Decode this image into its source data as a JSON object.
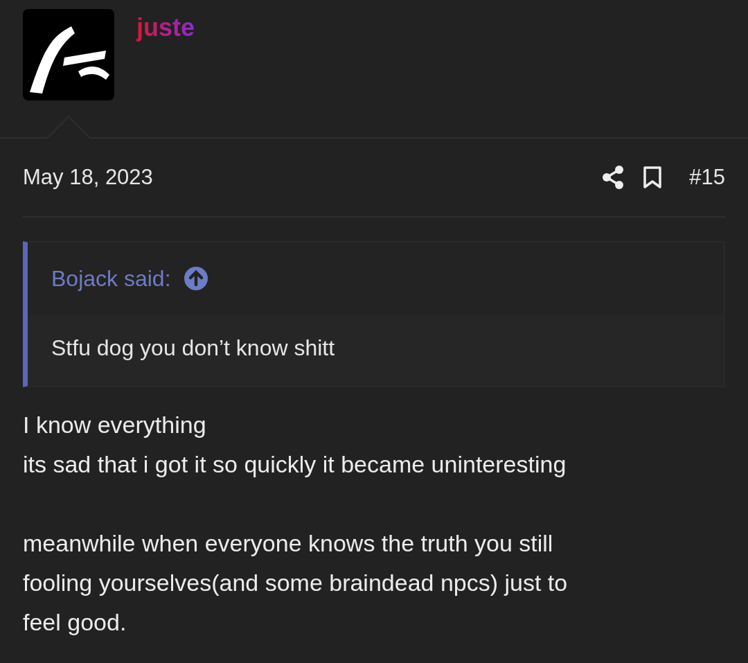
{
  "post": {
    "author": "juste",
    "date": "May 18, 2023",
    "number": "#15",
    "quote": {
      "author_line": "Bojack said:",
      "text": "Stfu dog you don’t know shitt"
    },
    "paragraphs": [
      "I know everything\nits sad that i got it so quickly it became uninteresting",
      "meanwhile when everyone knows the truth you still\nfooling yourselves(and some braindead npcs) just to\nfeel good."
    ]
  }
}
